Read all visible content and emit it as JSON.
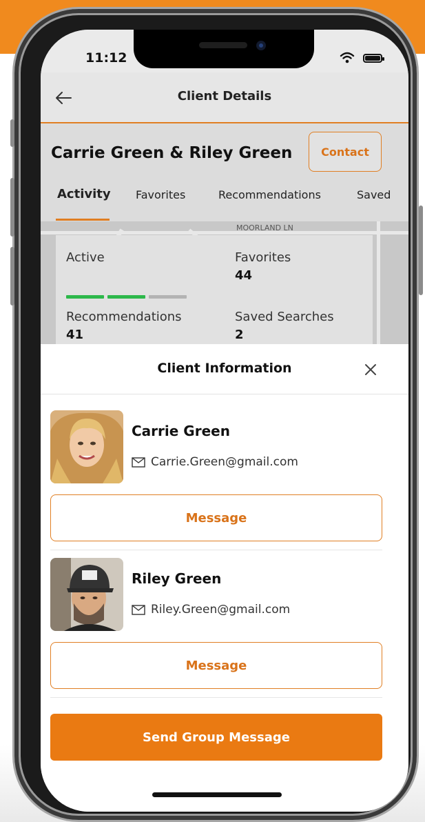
{
  "status_bar": {
    "time": "11:12"
  },
  "header": {
    "title": "Client Details"
  },
  "client": {
    "name": "Carrie Green & Riley Green",
    "contact_label": "Contact"
  },
  "tabs": [
    {
      "label": "Activity",
      "active": true
    },
    {
      "label": "Favorites"
    },
    {
      "label": "Recommendations"
    },
    {
      "label": "Saved"
    }
  ],
  "map": {
    "street_label": "MOORLAND LN"
  },
  "stats": {
    "active_label": "Active",
    "activity_level": 2,
    "activity_max": 3,
    "favorites_label": "Favorites",
    "favorites_value": "44",
    "recommendations_label": "Recommendations",
    "recommendations_value": "41",
    "saved_searches_label": "Saved Searches",
    "saved_searches_value": "2"
  },
  "sheet": {
    "title": "Client Information",
    "people": [
      {
        "name": "Carrie Green",
        "email": "Carrie.Green@gmail.com",
        "message_label": "Message"
      },
      {
        "name": "Riley Green",
        "email": "Riley.Green@gmail.com",
        "message_label": "Message"
      }
    ],
    "group_message_label": "Send Group Message"
  },
  "colors": {
    "accent": "#E07E22",
    "banner": "#F08A1E",
    "active_bar": "#2DB84A"
  },
  "icons": [
    "back-arrow-icon",
    "wifi-icon",
    "battery-icon",
    "close-icon",
    "mail-icon"
  ]
}
